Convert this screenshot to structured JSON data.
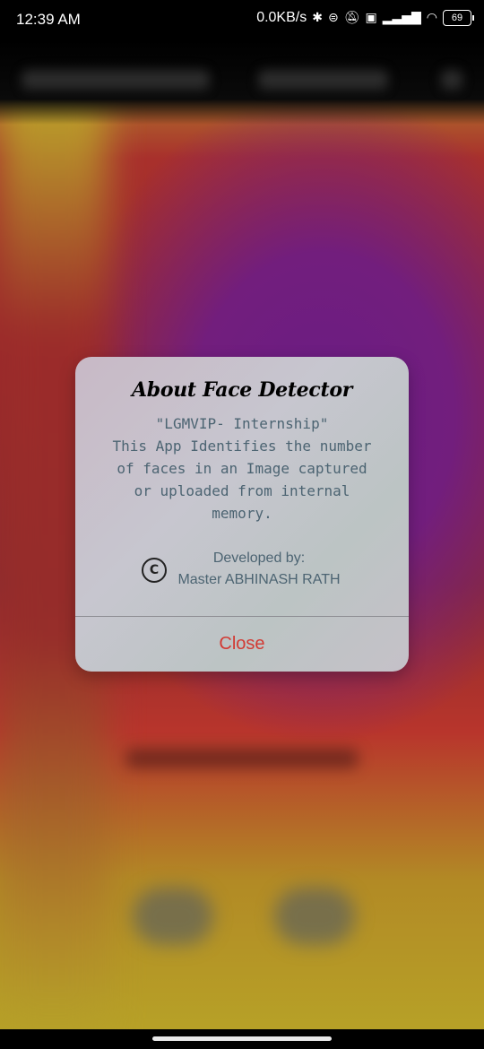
{
  "status_bar": {
    "time": "12:39 AM",
    "network_speed": "0.0KB/s",
    "icons": [
      "bluetooth-icon",
      "vpn-icon",
      "mute-icon",
      "volte-icon",
      "signal-icon",
      "wifi-icon",
      "battery-icon"
    ],
    "battery_level": "69"
  },
  "dialog": {
    "title": "About Face Detector",
    "message": "\"LGMVIP- Internship\"\nThis App Identifies the number\nof faces in an Image captured\nor uploaded from internal\nmemory.",
    "copyright_symbol": "C",
    "developed_by_label": "Developed by:",
    "developer_name": "Master ABHINASH RATH",
    "close_label": "Close"
  },
  "colors": {
    "accent_close": "#d23a33",
    "message_text": "#4c6472",
    "background_purple": "#6a1c84",
    "background_red": "#9b2a2a",
    "background_yellow": "#b7a127"
  }
}
